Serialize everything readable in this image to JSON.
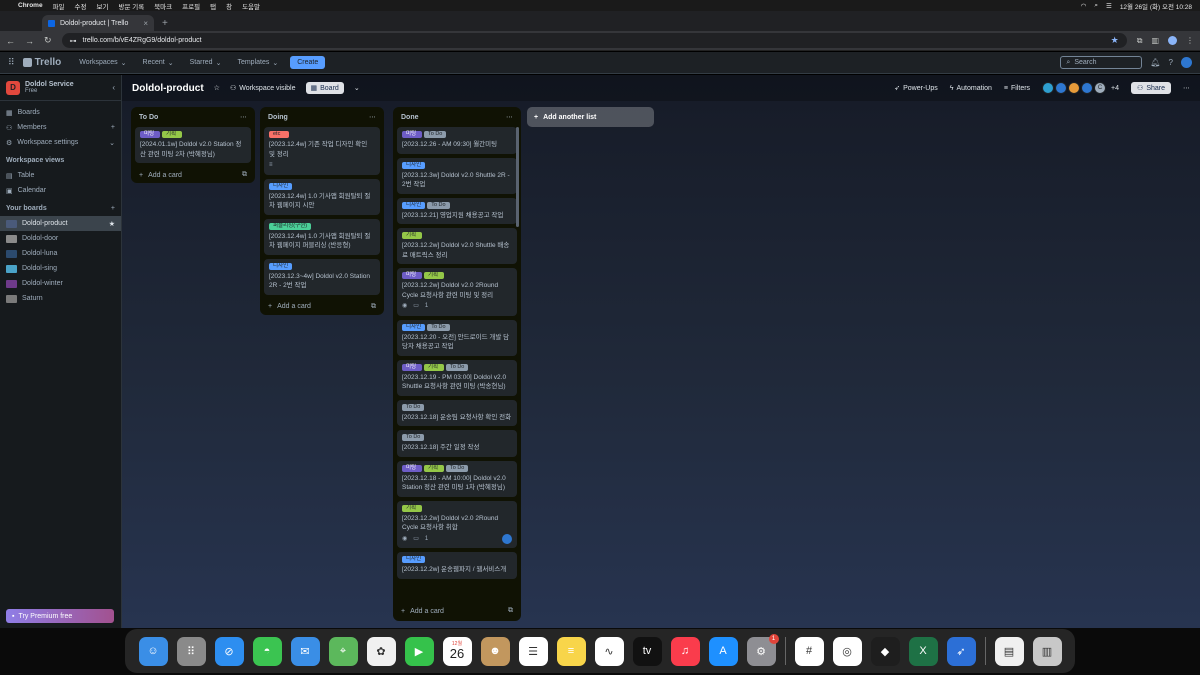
{
  "menubar": {
    "app": "Chrome",
    "items": [
      "파일",
      "수정",
      "보기",
      "방문 기록",
      "북마크",
      "프로필",
      "탭",
      "창",
      "도움말"
    ],
    "datetime": "12월 26일 (화) 오전 10:28"
  },
  "browser": {
    "tab_title": "Doldol-product | Trello",
    "url": "trello.com/b/vE4ZRgG9/doldol-product"
  },
  "trello_header": {
    "logo": "Trello",
    "menus": [
      "Workspaces",
      "Recent",
      "Starred",
      "Templates"
    ],
    "create_label": "Create",
    "search_placeholder": "Search"
  },
  "sidebar": {
    "workspace_name": "Doldol Service",
    "workspace_plan": "Free",
    "workspace_initial": "D",
    "items": [
      {
        "label": "Boards",
        "icon": "board-icon"
      },
      {
        "label": "Members",
        "icon": "members-icon"
      },
      {
        "label": "Workspace settings",
        "icon": "gear-icon"
      }
    ],
    "views_title": "Workspace views",
    "views": [
      {
        "label": "Table",
        "icon": "table-icon"
      },
      {
        "label": "Calendar",
        "icon": "calendar-icon"
      }
    ],
    "boards_title": "Your boards",
    "boards": [
      {
        "label": "Doldol-product",
        "color": "#4a5a7a"
      },
      {
        "label": "Doldol-door",
        "color": "#8a8a8a"
      },
      {
        "label": "Doldol-luna",
        "color": "#2b4a6e"
      },
      {
        "label": "Doldol-sing",
        "color": "#4aa3c8"
      },
      {
        "label": "Doldol-winter",
        "color": "#6e3a8a"
      },
      {
        "label": "Saturn",
        "color": "#7a7a7a"
      }
    ],
    "premium_label": "Try Premium free"
  },
  "board": {
    "title": "Doldol-product",
    "visibility": "Workspace visible",
    "view_label": "Board",
    "power_ups": "Power-Ups",
    "automation": "Automation",
    "filters": "Filters",
    "member_extra": "+4",
    "member_initial": "C",
    "share": "Share",
    "add_list": "Add another list"
  },
  "lists": [
    {
      "title": "To Do",
      "cards": [
        {
          "labels": [
            {
              "text": "미팅",
              "color": "purple"
            },
            {
              "text": "기획",
              "color": "lime"
            }
          ],
          "title": "[2024.01.1w] Doldol v2.0 Station 정산 관련 미팅 2차 (박혜정님)"
        }
      ],
      "add_card": "Add a card"
    },
    {
      "title": "Doing",
      "cards": [
        {
          "labels": [
            {
              "text": "etc",
              "color": "red"
            }
          ],
          "title": "[2023.12.4w] 기존 작업 디자인 확인 및 정리",
          "description": true
        },
        {
          "labels": [
            {
              "text": "디자인",
              "color": "blue"
            }
          ],
          "title": "[2023.12.4w] 1.0 기사앱 회원탈퇴 절차 웹페이지 시안"
        },
        {
          "labels": [
            {
              "text": "퍼블리싱(구현)",
              "color": "green"
            }
          ],
          "title": "[2023.12.4w] 1.0 기사앱 회원탈퇴 절차 웹페이지 퍼블리싱 (반응형)"
        },
        {
          "labels": [
            {
              "text": "디자인",
              "color": "blue"
            }
          ],
          "title": "[2023.12.3~4w] Doldol v2.0 Station 2R - 2번 작업"
        }
      ],
      "add_card": "Add a card"
    },
    {
      "title": "Done",
      "cards": [
        {
          "labels": [
            {
              "text": "미팅",
              "color": "purple"
            },
            {
              "text": "To Do",
              "color": "gray"
            }
          ],
          "title": "[2023.12.26 - AM 09:30] 월간미팅"
        },
        {
          "labels": [
            {
              "text": "디자인",
              "color": "blue"
            }
          ],
          "title": "[2023.12.3w] Doldol v2.0 Shuttle 2R - 2번 작업"
        },
        {
          "labels": [
            {
              "text": "디자인",
              "color": "blue"
            },
            {
              "text": "To Do",
              "color": "gray"
            }
          ],
          "title": "[2023.12.21] 영업지원 채용공고 작업"
        },
        {
          "labels": [
            {
              "text": "기획",
              "color": "lime"
            }
          ],
          "title": "[2023.12.2w] Doldol v2.0 Shuttle 배송료 매트릭스 정리"
        },
        {
          "labels": [
            {
              "text": "미팅",
              "color": "purple"
            },
            {
              "text": "기획",
              "color": "lime"
            }
          ],
          "title": "[2023.12.2w] Doldol v2.0 2Round Cycle 요청사항 관련 미팅 및 정리",
          "comments": "1"
        },
        {
          "labels": [
            {
              "text": "디자인",
              "color": "blue"
            },
            {
              "text": "To Do",
              "color": "gray"
            }
          ],
          "title": "[2023.12.20 - 오전] 안드로이드 개발 담당자 채용공고 작업"
        },
        {
          "labels": [
            {
              "text": "미팅",
              "color": "purple"
            },
            {
              "text": "기획",
              "color": "lime"
            },
            {
              "text": "To Do",
              "color": "gray"
            }
          ],
          "title": "[2023.12.19 - PM 03:00] Doldol v2.0 Shuttle 요청사항 관련 미팅 (박송현님)"
        },
        {
          "labels": [
            {
              "text": "To Do",
              "color": "gray"
            }
          ],
          "title": "[2023.12.18] 운송팀 요청사항 확인 전화"
        },
        {
          "labels": [
            {
              "text": "To Do",
              "color": "gray"
            }
          ],
          "title": "[2023.12.18] 주간 일정 작성"
        },
        {
          "labels": [
            {
              "text": "미팅",
              "color": "purple"
            },
            {
              "text": "기획",
              "color": "lime"
            },
            {
              "text": "To Do",
              "color": "gray"
            }
          ],
          "title": "[2023.12.18 - AM 10:00] Doldol v2.0 Station 정산 관련 미팅 1차 (박혜정님)"
        },
        {
          "labels": [
            {
              "text": "기획",
              "color": "lime"
            }
          ],
          "title": "[2023.12.2w] Doldol v2.0 2Round Cycle 요청사항 취합",
          "comments": "1",
          "member": true
        },
        {
          "labels": [
            {
              "text": "디자인",
              "color": "blue"
            }
          ],
          "title": "[2023.12.2w] 운송웹파지 / 웹서비스개"
        }
      ],
      "add_card": "Add a card"
    }
  ],
  "dock": {
    "calendar_month": "12월",
    "calendar_day": "26",
    "settings_badge": "1",
    "apps": [
      {
        "name": "finder",
        "color": "#3a8ee6"
      },
      {
        "name": "launchpad",
        "color": "#8a8a8a"
      },
      {
        "name": "safari",
        "color": "#2d8ef0"
      },
      {
        "name": "messages",
        "color": "#3bc451"
      },
      {
        "name": "mail",
        "color": "#3a8ee6"
      },
      {
        "name": "maps",
        "color": "#5cb85c"
      },
      {
        "name": "photos",
        "color": "#f0f0f0"
      },
      {
        "name": "facetime",
        "color": "#35c24b"
      },
      {
        "name": "calendar",
        "color": "#ffffff"
      },
      {
        "name": "contacts",
        "color": "#c2975e"
      },
      {
        "name": "reminders",
        "color": "#ffffff"
      },
      {
        "name": "notes",
        "color": "#f8d54a"
      },
      {
        "name": "freeform",
        "color": "#ffffff"
      },
      {
        "name": "tv",
        "color": "#111111"
      },
      {
        "name": "music",
        "color": "#fa3c4c"
      },
      {
        "name": "app-store",
        "color": "#1e90ff"
      },
      {
        "name": "system-settings",
        "color": "#8e8e93"
      },
      {
        "name": "slack",
        "color": "#ffffff"
      },
      {
        "name": "chrome",
        "color": "#ffffff"
      },
      {
        "name": "figma",
        "color": "#1e1e1e"
      },
      {
        "name": "excel",
        "color": "#1e7145"
      },
      {
        "name": "bird-app",
        "color": "#2c6fd6"
      },
      {
        "name": "xlsx-file",
        "color": "#f0f0f0"
      },
      {
        "name": "trash",
        "color": "#c8c8c8"
      }
    ]
  }
}
